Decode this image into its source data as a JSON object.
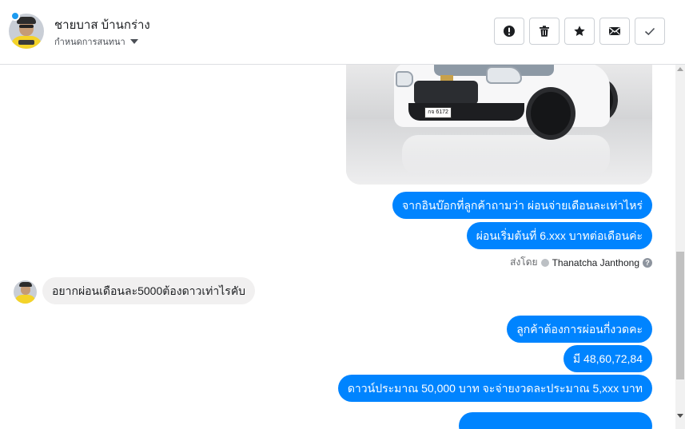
{
  "header": {
    "name": "ชายบาส บ้านกร่าง",
    "status_label": "กำหนดการสนทนา",
    "actions": {
      "report": "report-icon",
      "delete": "trash-icon",
      "star": "star-icon",
      "mail": "mail-icon",
      "done": "check-icon"
    }
  },
  "conversation": {
    "image": {
      "plate_text": "กจ 6172"
    },
    "outgoing_1": [
      "จากอินบ๊อกที่ลูกค้าถามว่า ผ่อนจ่ายเดือนละเท่าไหร่",
      "ผ่อนเริ่มต้นที่ 6.xxx บาทต่อเดือนค่ะ"
    ],
    "sent_by": {
      "prefix": "ส่งโดย",
      "agent": "Thanatcha Janthong"
    },
    "incoming": [
      "อยากผ่อนเดือนละ5000ต้องดาวเท่าไรคับ"
    ],
    "outgoing_2": [
      "ลูกค้าต้องการผ่อนกี่งวดคะ",
      "มี 48,60,72,84",
      "ดาวน์ประมาณ 50,000 บาท จะจ่ายงวดละประมาณ 5,xxx บาท"
    ]
  },
  "colors": {
    "outgoing_bubble": "#0084ff",
    "incoming_bubble": "#f1f0f0"
  }
}
